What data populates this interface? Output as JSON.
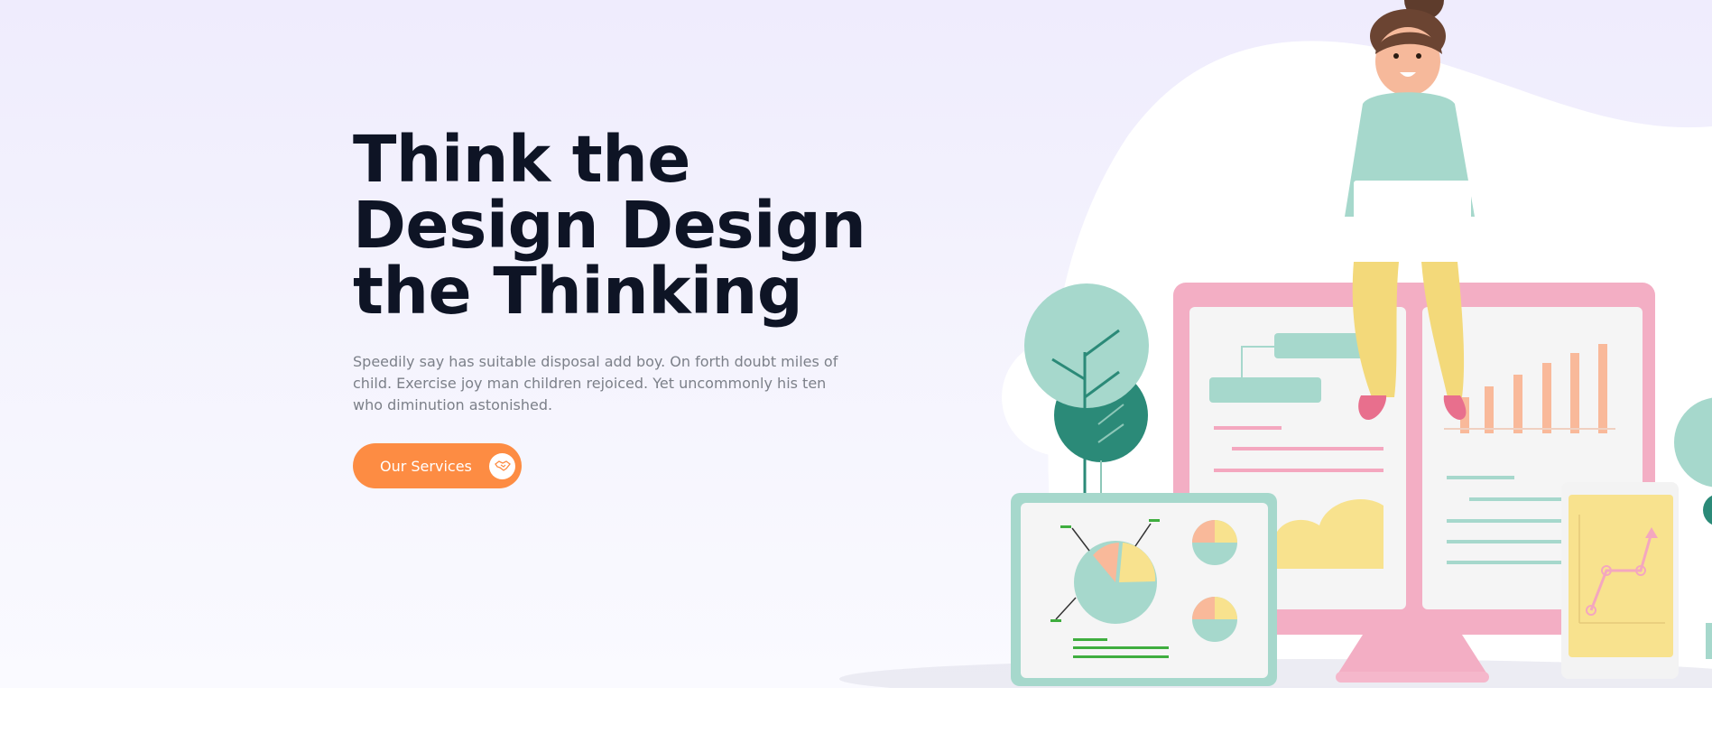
{
  "hero": {
    "title_lines": [
      "Think the",
      "Design Design",
      "the Thinking"
    ],
    "description": "Speedily say has suitable disposal add boy. On forth doubt miles of child. Exercise joy man children rejoiced. Yet uncommonly his ten who diminution astonished.",
    "cta_label": "Our Services",
    "cta_icon": "handshake-icon"
  },
  "colors": {
    "background_top": "#efecfd",
    "title": "#0e1425",
    "body_text": "#7c8089",
    "accent": "#fd8c43",
    "monitor_pink": "#f3aec4",
    "teal": "#9ed6c8",
    "yellow": "#f8e28e"
  }
}
